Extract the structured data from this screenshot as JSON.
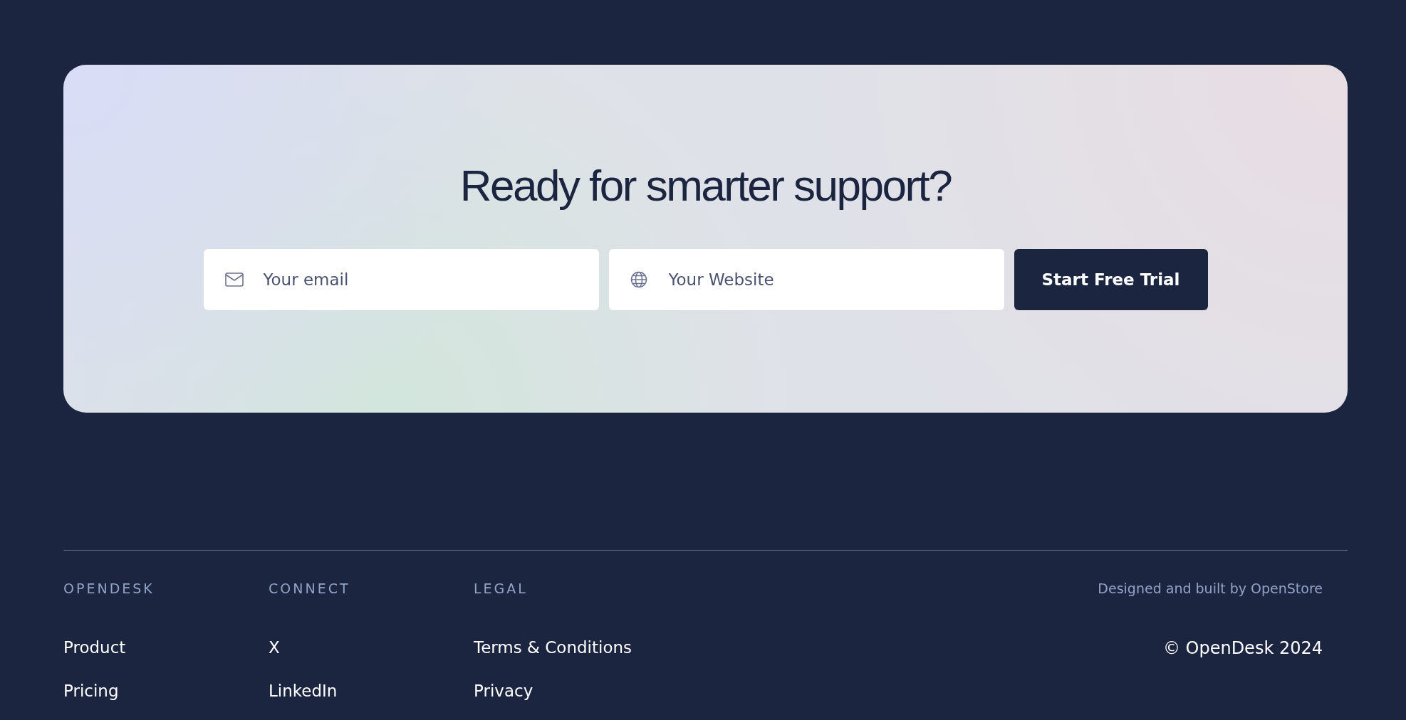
{
  "cta": {
    "title": "Ready for smarter support?",
    "email_field": {
      "placeholder": "Your email"
    },
    "website_field": {
      "placeholder": "Your Website"
    },
    "button": "Start Free Trial"
  },
  "footer": {
    "columns": [
      {
        "heading": "OPENDESK",
        "links": [
          "Product",
          "Pricing"
        ]
      },
      {
        "heading": "CONNECT",
        "links": [
          "X",
          "LinkedIn"
        ]
      },
      {
        "heading": "LEGAL",
        "links": [
          "Terms & Conditions",
          "Privacy"
        ]
      }
    ],
    "credit": "Designed and built by OpenStore",
    "copyright": "© OpenDesk 2024"
  }
}
